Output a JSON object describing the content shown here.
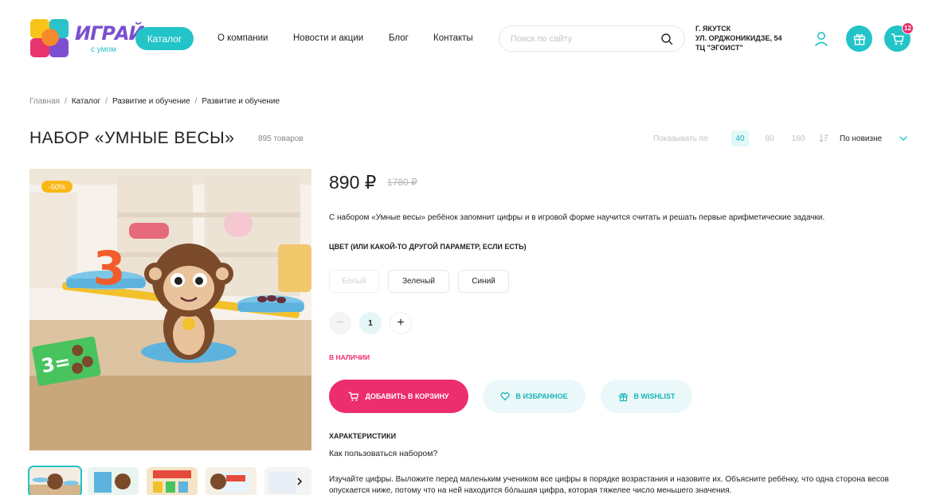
{
  "header": {
    "logo_text": "ИГРАЙ",
    "logo_sub": "с умом",
    "catalog_button": "Каталог",
    "nav": [
      "О компании",
      "Новости и акции",
      "Блог",
      "Контакты"
    ],
    "search_placeholder": "Поиск по сайту",
    "address": [
      "г. Якутск",
      "ул. Орджоникидзе, 54",
      "ТЦ \"Эгоист\""
    ],
    "cart_count": "12"
  },
  "breadcrumb": [
    "Главная",
    "Каталог",
    "Развитие и обучение",
    "Развитие и обучение"
  ],
  "title_row": {
    "title": "НАБОР «УМНЫЕ ВЕСЫ»",
    "count": "895 товаров",
    "show_per_label": "Показывать по",
    "per_page_options": [
      "40",
      "80",
      "160"
    ],
    "per_page_selected": "40",
    "sort_label": "По новизне"
  },
  "product": {
    "discount_badge": "-50%",
    "price": "890 ₽",
    "old_price": "1780 ₽",
    "description": "С набором «Умные весы» ребёнок запомнит цифры и в игровой форме научится считать и решать первые арифметические задачки.",
    "param_title": "Цвет (или какой-то другой параметр, если есть)",
    "variants": [
      {
        "label": "Белый",
        "disabled": true
      },
      {
        "label": "Зеленый",
        "disabled": false
      },
      {
        "label": "Синий",
        "disabled": false
      }
    ],
    "quantity": "1",
    "stock": "В наличии",
    "add_to_cart": "Добавить в корзину",
    "to_favorites": "В избранное",
    "to_wishlist": "В wishlist",
    "characteristics_title": "Характеристики",
    "characteristics_question": "Как пользоваться набором?",
    "characteristics_text": "Изучайте цифры. Выложите перед маленьким учеником все цифры в порядке возрастания и назовите их. Объясните ребёнку, что одна сторона весов опускается ниже, потому что на ней находится бóльшая цифра, которая тяжелее число меньшего значения."
  },
  "colors": {
    "accent": "#22c4c8",
    "pink": "#ec2d6e",
    "badge": "#f9b715"
  }
}
